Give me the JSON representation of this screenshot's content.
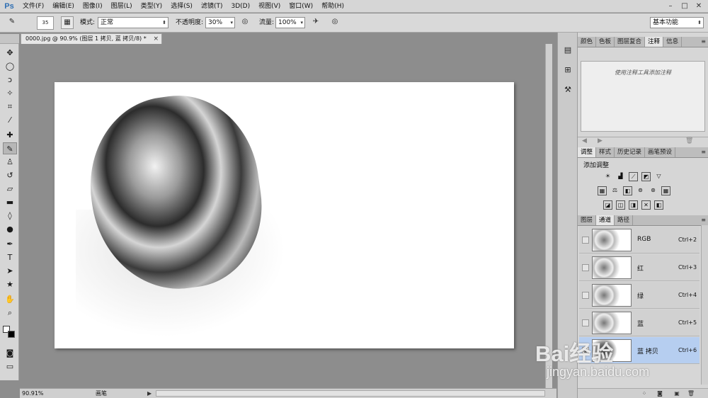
{
  "app": {
    "logo": "Ps"
  },
  "menubar": {
    "items": [
      "文件(F)",
      "编辑(E)",
      "图像(I)",
      "图层(L)",
      "类型(Y)",
      "选择(S)",
      "滤镜(T)",
      "3D(D)",
      "视图(V)",
      "窗口(W)",
      "帮助(H)"
    ],
    "minimize": "–",
    "maximize": "□",
    "close": "✕"
  },
  "options": {
    "brush_size": "35",
    "mode_label": "模式:",
    "mode_value": "正常",
    "opacity_label": "不透明度:",
    "opacity_value": "30%",
    "flow_label": "流量:",
    "flow_value": "100%",
    "workspace": "基本功能"
  },
  "document": {
    "tab_title": "0000.jpg @ 90.9% (图层 1 拷贝, 蓝 拷贝/8) *",
    "tab_close": "×"
  },
  "status": {
    "zoom": "90.91%",
    "tool_label": "画笔",
    "arrow": "▶"
  },
  "panels": {
    "group1_tabs": [
      "颜色",
      "色板",
      "图层复合",
      "注释",
      "信息"
    ],
    "group1_active": "注释",
    "notes_hint": "使用注释工具添加注释",
    "group2_tabs": [
      "调整",
      "样式",
      "历史记录",
      "画笔预设"
    ],
    "group2_active": "调整",
    "adjust_title": "添加调整",
    "group3_tabs": [
      "图层",
      "通道",
      "路径"
    ],
    "group3_active": "通道",
    "channels": [
      {
        "name": "RGB",
        "shortcut": "Ctrl+2",
        "selected": false
      },
      {
        "name": "红",
        "shortcut": "Ctrl+3",
        "selected": false
      },
      {
        "name": "绿",
        "shortcut": "Ctrl+4",
        "selected": false
      },
      {
        "name": "蓝",
        "shortcut": "Ctrl+5",
        "selected": false
      },
      {
        "name": "蓝 拷贝",
        "shortcut": "Ctrl+6",
        "selected": true
      }
    ]
  },
  "watermark": {
    "brand": "Bai经验",
    "url": "jingyan.baidu.com"
  },
  "colors": {
    "selection": "#b6cef0",
    "canvas_bg": "#8d8d8d",
    "ps_blue": "#2f6fb3"
  }
}
